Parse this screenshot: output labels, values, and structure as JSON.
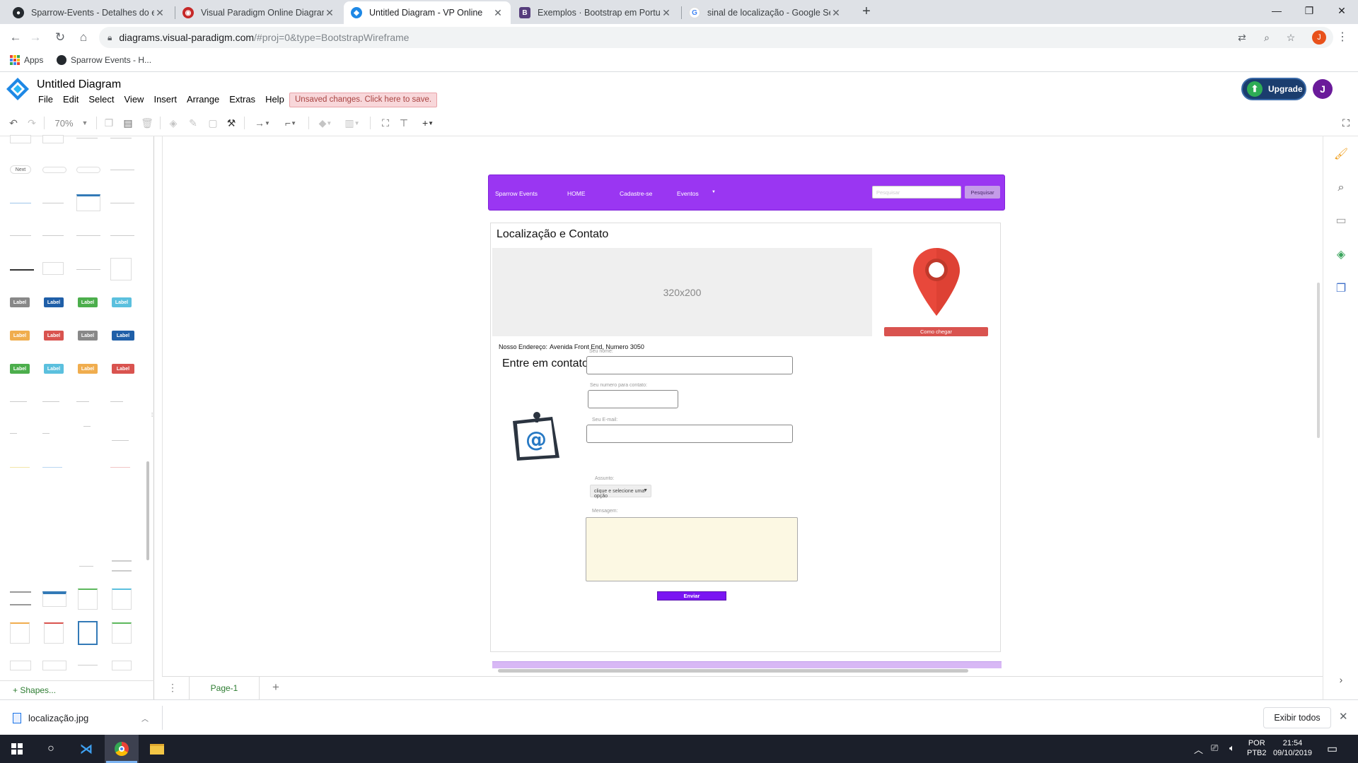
{
  "browser": {
    "tabs": [
      {
        "title": "Sparrow-Events - Detalhes do ev",
        "icon": "github-icon"
      },
      {
        "title": "Visual Paradigm Online Diagram",
        "icon": "vp-icon"
      },
      {
        "title": "Untitled Diagram - VP Online",
        "icon": "vp-online-icon"
      },
      {
        "title": "Exemplos · Bootstrap em Portugu",
        "icon": "bootstrap-icon"
      },
      {
        "title": "sinal de localização - Google Sea",
        "icon": "google-icon"
      }
    ],
    "url_host": "diagrams.visual-paradigm.com",
    "url_rest": "/#proj=0&type=BootstrapWireframe",
    "profile_initial": "J",
    "bookmarks": [
      "Apps",
      "Sparrow Events - H..."
    ]
  },
  "app": {
    "title": "Untitled Diagram",
    "menu": [
      "File",
      "Edit",
      "Select",
      "View",
      "Insert",
      "Arrange",
      "Extras",
      "Help"
    ],
    "unsaved_notice": "Unsaved changes. Click here to save.",
    "upgrade_label": "Upgrade",
    "avatar_initial": "J",
    "zoom": "70%",
    "shapes_link": "+ Shapes...",
    "page_tab": "Page-1"
  },
  "shapes_panel": {
    "label_badges": [
      {
        "text": "Label",
        "color": "#888888"
      },
      {
        "text": "Label",
        "color": "#1f5fa8"
      },
      {
        "text": "Label",
        "color": "#4cae4c"
      },
      {
        "text": "Label",
        "color": "#5bc0de"
      },
      {
        "text": "Label",
        "color": "#f0ad4e"
      },
      {
        "text": "Label",
        "color": "#d9534f"
      },
      {
        "text": "Label",
        "color": "#888888"
      },
      {
        "text": "Label",
        "color": "#1f5fa8"
      },
      {
        "text": "Label",
        "color": "#4cae4c"
      },
      {
        "text": "Label",
        "color": "#5bc0de"
      },
      {
        "text": "Label",
        "color": "#f0ad4e"
      },
      {
        "text": "Label",
        "color": "#d9534f"
      }
    ],
    "pill_text": "Next"
  },
  "wireframe": {
    "nav": {
      "brand": "Sparrow Events",
      "links": [
        "HOME",
        "Cadastre-se",
        "Eventos"
      ],
      "search_placeholder": "Pesquisar",
      "search_button": "Pesquisar"
    },
    "section_title": "Localização e Contato",
    "image_placeholder": "320x200",
    "directions_button": "Como chegar",
    "address_label": "Nosso Endereço:",
    "address_value": "Avenida Front End, Numero 3050",
    "contact_title": "Entre em contato conosco",
    "fields": {
      "name_label": "Seu nome:",
      "phone_label": "Seu numero para contato:",
      "email_label": "Seu E-mail:",
      "subject_label": "Assunto:",
      "subject_value": "clique e selecione uma opção",
      "message_label": "Mensagem:"
    },
    "submit_button": "Enviar",
    "accent_color": "#9a36f2"
  },
  "downloads": {
    "file_name": "localização.jpg",
    "show_all": "Exibir todos"
  },
  "taskbar": {
    "lang": "POR",
    "layout": "PTB2",
    "time": "21:54",
    "date": "09/10/2019"
  }
}
